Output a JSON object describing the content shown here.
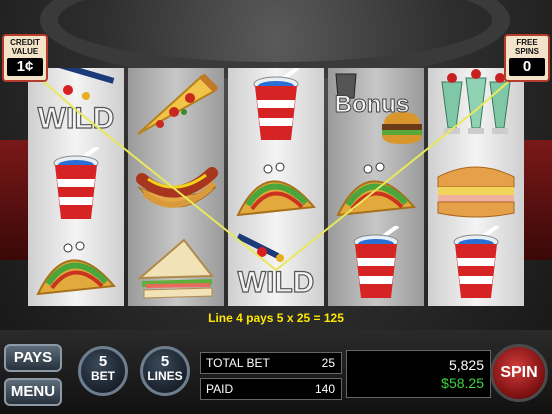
{
  "game": {
    "credit_value": {
      "label_line1": "CREDIT",
      "label_line2": "VALUE",
      "value": "1¢"
    },
    "free_spins": {
      "label_line1": "FREE",
      "label_line2": "SPINS",
      "value": "0"
    },
    "reels": [
      [
        "wild",
        "soda",
        "taco"
      ],
      [
        "pizza",
        "hotdog",
        "sandwich"
      ],
      [
        "soda",
        "taco",
        "wild"
      ],
      [
        "bonus",
        "taco",
        "soda"
      ],
      [
        "milkshakes",
        "grilled-sandwich",
        "soda"
      ]
    ],
    "symbol_text": {
      "wild": "WILD",
      "bonus": "Bonus"
    },
    "win_message": "Line 4 pays 5 x 25 = 125",
    "buttons": {
      "pays": "PAYS",
      "menu": "MENU",
      "spin": "SPIN"
    },
    "bet": {
      "value": "5",
      "label": "BET"
    },
    "lines": {
      "value": "5",
      "label": "LINES"
    },
    "total_bet": {
      "label": "TOTAL BET",
      "value": "25"
    },
    "paid": {
      "label": "PAID",
      "value": "140"
    },
    "credits": "5,825",
    "balance": "$58.25",
    "colors": {
      "payline": "#e8e85a",
      "message": "#ffe800",
      "balance": "#3dd43d",
      "spin_button": "#b52020",
      "frame_border": "#b43a2a"
    }
  }
}
